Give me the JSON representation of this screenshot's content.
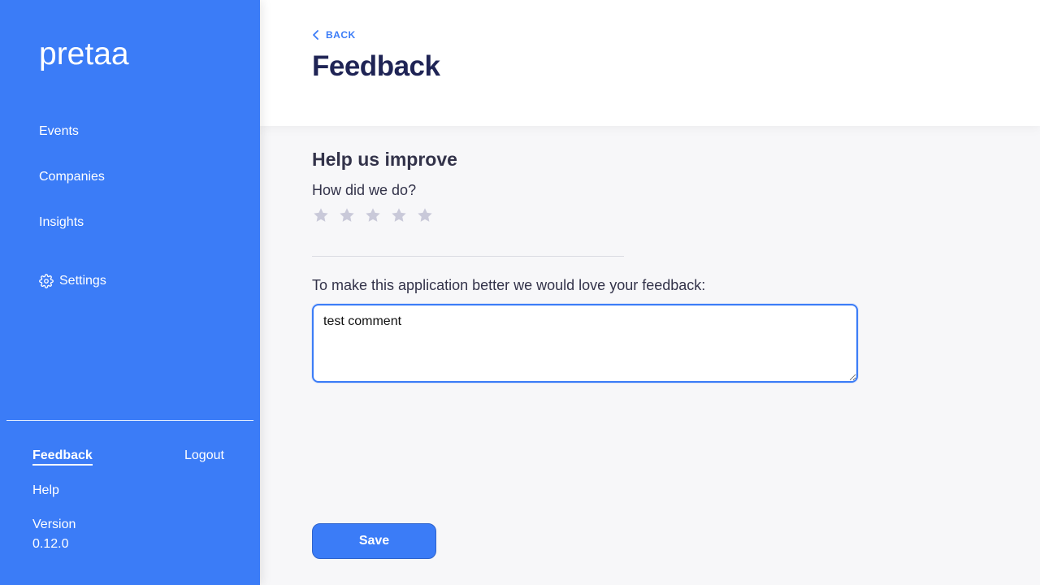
{
  "brand": {
    "logo_text": "pretaa",
    "accent": "#3b7cf7"
  },
  "sidebar": {
    "nav": [
      {
        "label": "Events"
      },
      {
        "label": "Companies"
      },
      {
        "label": "Insights"
      },
      {
        "label": "Settings",
        "icon": "gear-icon"
      }
    ],
    "footer": {
      "feedback_label": "Feedback",
      "logout_label": "Logout",
      "help_label": "Help",
      "version_label": "Version",
      "version_number": "0.12.0"
    }
  },
  "header": {
    "back_label": "BACK",
    "title": "Feedback"
  },
  "form": {
    "section_title": "Help us improve",
    "rating_question": "How did we do?",
    "rating": {
      "value": 0,
      "max": 5,
      "empty_color": "#c9c9d9"
    },
    "comment_prompt": "To make this application better we would love your feedback:",
    "comment_value": "test comment",
    "save_label": "Save"
  }
}
